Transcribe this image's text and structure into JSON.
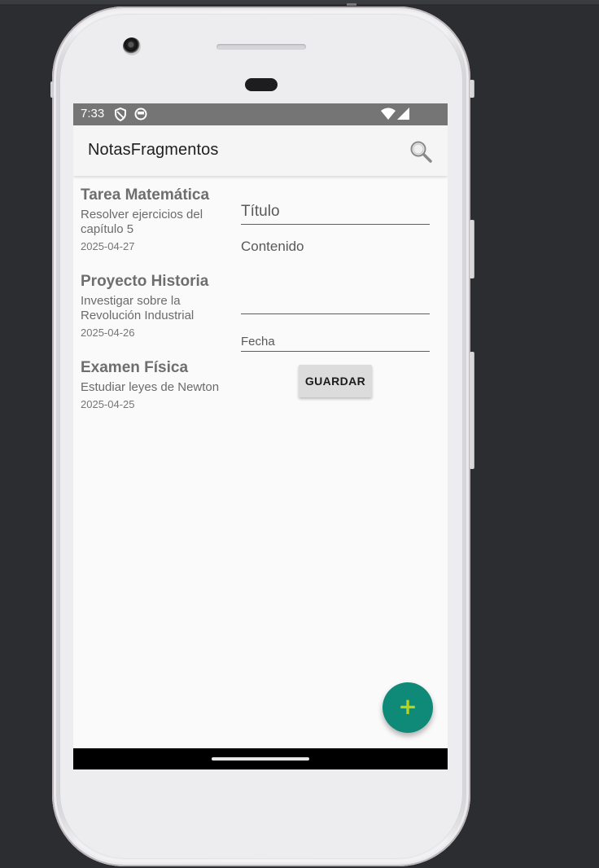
{
  "status_bar": {
    "time": "7:33"
  },
  "app_bar": {
    "title": "NotasFragmentos"
  },
  "notes": [
    {
      "title": "Tarea Matemática",
      "description": "Resolver ejercicios del capítulo 5",
      "date": "2025-04-27"
    },
    {
      "title": "Proyecto Historia",
      "description": "Investigar sobre la Revolución Industrial",
      "date": "2025-04-26"
    },
    {
      "title": "Examen Física",
      "description": "Estudiar leyes de Newton",
      "date": "2025-04-25"
    }
  ],
  "form": {
    "title_placeholder": "Título",
    "content_placeholder": "Contenido",
    "date_placeholder": "Fecha",
    "save_label": "GUARDAR"
  },
  "fab": {
    "label": "+"
  },
  "icons": {
    "search": "search-icon",
    "shield": "shield-icon",
    "app_notification": "notification-icon",
    "wifi": "wifi-icon",
    "signal": "signal-icon",
    "add": "add-icon"
  },
  "colors": {
    "status_bar": "#757575",
    "app_bar": "#f5f5f5",
    "fab": "#0f8a78",
    "fab_icon": "#b9d31a",
    "button": "#dcdcdc"
  }
}
